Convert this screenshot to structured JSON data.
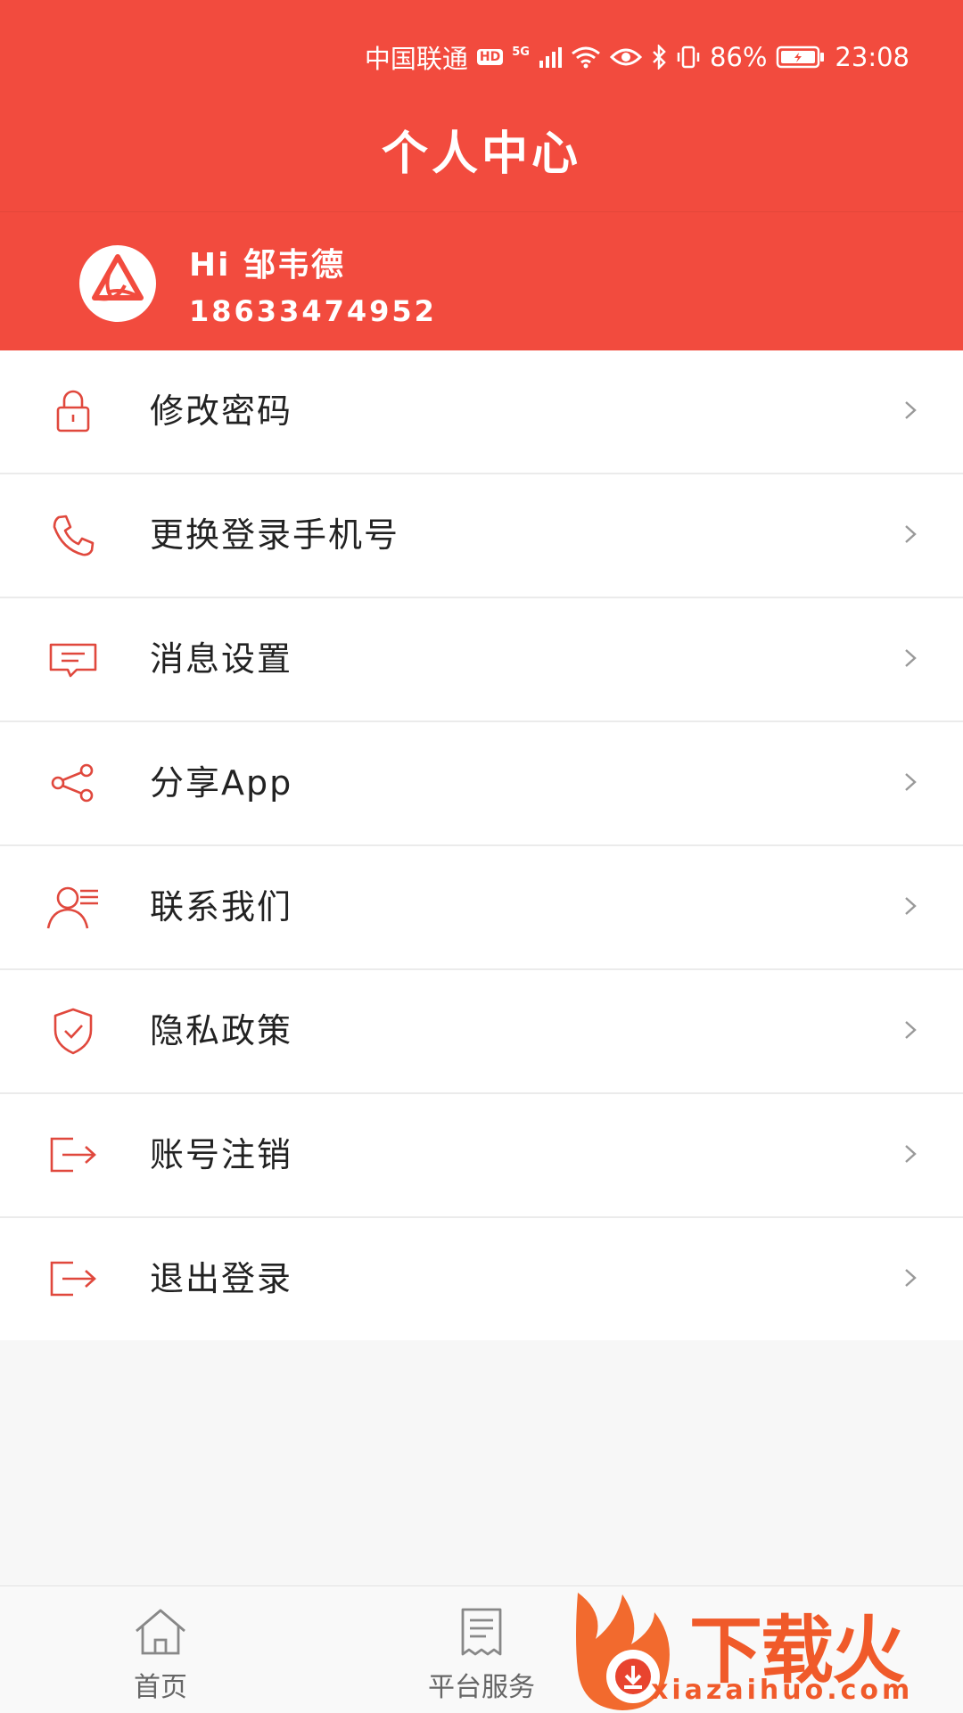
{
  "status_bar": {
    "carrier": "中国联通",
    "hd_badge": "HD",
    "network": "5G",
    "battery": "86%",
    "time": "23:08"
  },
  "header": {
    "title": "个人中心"
  },
  "profile": {
    "greeting": "Hi 邹韦德",
    "phone": "18633474952"
  },
  "menu": [
    {
      "label": "修改密码",
      "icon": "lock-icon"
    },
    {
      "label": "更换登录手机号",
      "icon": "phone-icon"
    },
    {
      "label": "消息设置",
      "icon": "message-icon"
    },
    {
      "label": "分享App",
      "icon": "share-icon"
    },
    {
      "label": "联系我们",
      "icon": "contact-icon"
    },
    {
      "label": "隐私政策",
      "icon": "shield-icon"
    },
    {
      "label": "账号注销",
      "icon": "exit-icon"
    },
    {
      "label": "退出登录",
      "icon": "exit-icon"
    }
  ],
  "bottom_nav": [
    {
      "label": "首页",
      "icon": "home-icon"
    },
    {
      "label": "平台服务",
      "icon": "receipt-icon"
    }
  ],
  "watermark": {
    "brand": "下载火",
    "url": "xiazaihuo.com"
  },
  "colors": {
    "primary": "#f24b3e",
    "icon": "#e0483d"
  }
}
